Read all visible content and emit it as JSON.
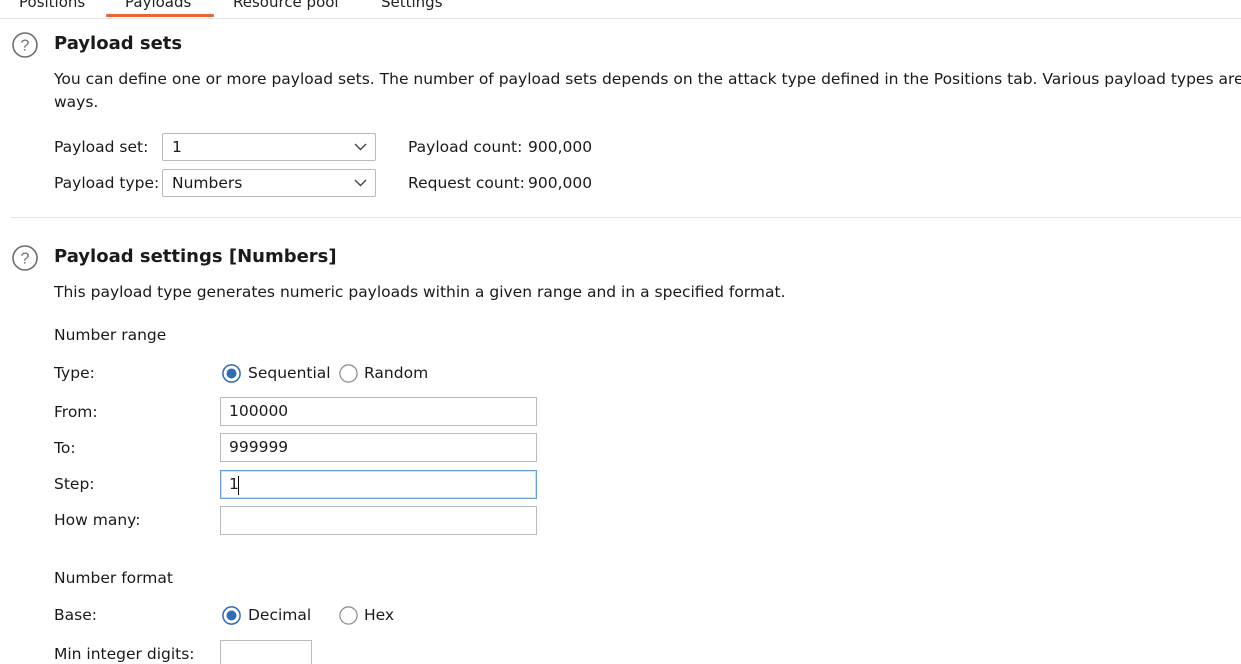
{
  "tabs": [
    {
      "label": "Positions"
    },
    {
      "label": "Payloads"
    },
    {
      "label": "Resource pool"
    },
    {
      "label": "Settings"
    }
  ],
  "active_tab": "Payloads",
  "accent_color": "#e8643a",
  "payload_sets": {
    "title": "Payload sets",
    "description": "You can define one or more payload sets. The number of payload sets depends on the attack type defined in the Positions tab. Various payload types are av",
    "description_tail": "ways.",
    "payload_set_label": "Payload set:",
    "payload_set_value": "1",
    "payload_type_label": "Payload type:",
    "payload_type_value": "Numbers",
    "payload_count_label": "Payload count:",
    "payload_count_value": "900,000",
    "request_count_label": "Request count:",
    "request_count_value": "900,000"
  },
  "payload_settings": {
    "title": "Payload settings [Numbers]",
    "description": "This payload type generates numeric payloads within a given range and in a specified format.",
    "number_range_heading": "Number range",
    "type_label": "Type:",
    "type_options": [
      "Sequential",
      "Random"
    ],
    "type_selected": "Sequential",
    "from_label": "From:",
    "from_value": "100000",
    "to_label": "To:",
    "to_value": "999999",
    "step_label": "Step:",
    "step_value": "1",
    "how_many_label": "How many:",
    "how_many_value": "",
    "number_format_heading": "Number format",
    "base_label": "Base:",
    "base_options": [
      "Decimal",
      "Hex"
    ],
    "base_selected": "Decimal",
    "min_integer_digits_label": "Min integer digits:",
    "min_integer_digits_value": ""
  }
}
